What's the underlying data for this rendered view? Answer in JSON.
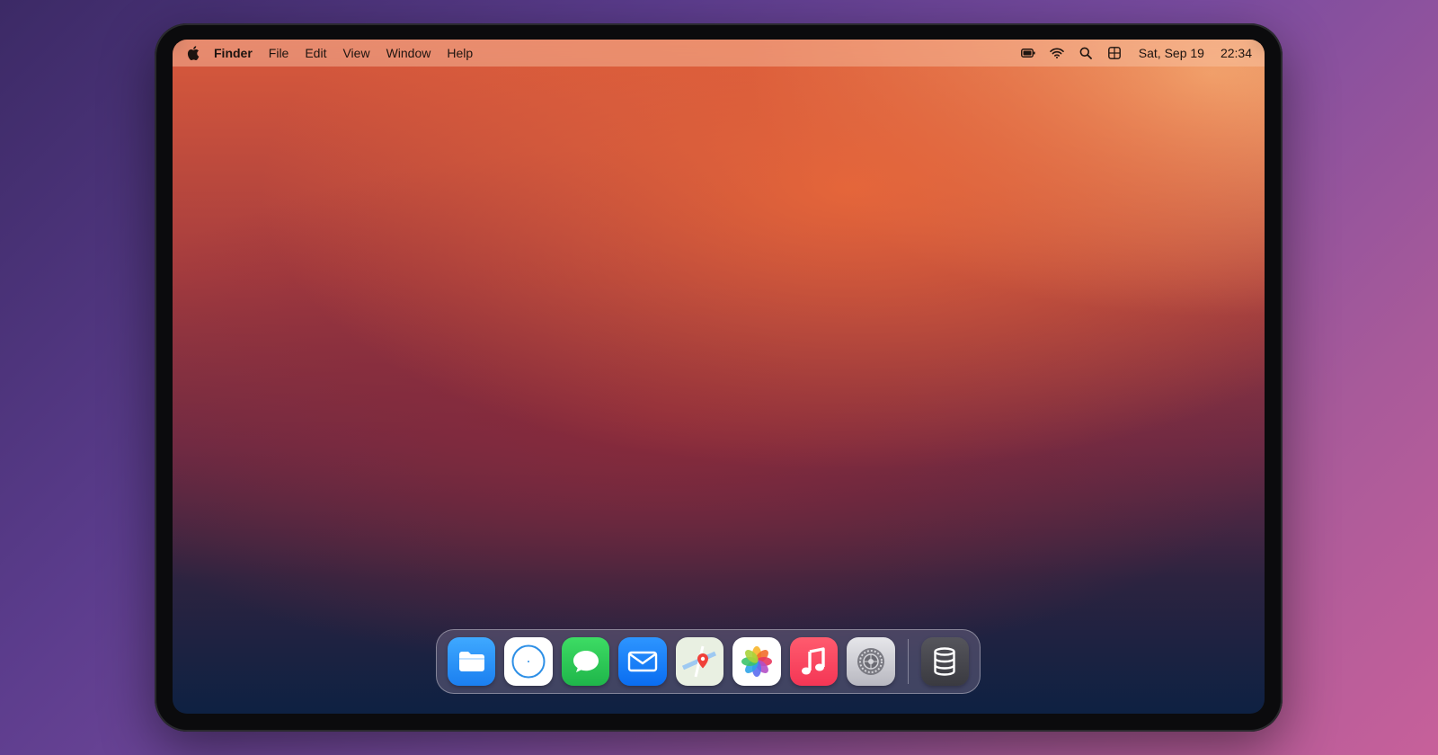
{
  "menubar": {
    "app_name": "Finder",
    "menus": [
      "File",
      "Edit",
      "View",
      "Window",
      "Help"
    ],
    "date": "Sat, Sep 19",
    "time": "22:34",
    "status_icons": [
      "battery-icon",
      "wifi-icon",
      "search-icon",
      "control-center-icon"
    ]
  },
  "dock": {
    "apps": [
      "finder",
      "safari",
      "messages",
      "mail",
      "maps",
      "photos",
      "music",
      "system-settings",
      "database"
    ]
  },
  "colors": {
    "wallpaper_top": "#e7673a",
    "wallpaper_mid": "#8c2a3a",
    "wallpaper_bottom": "#0e2142",
    "backdrop": "#6a4a9c"
  }
}
